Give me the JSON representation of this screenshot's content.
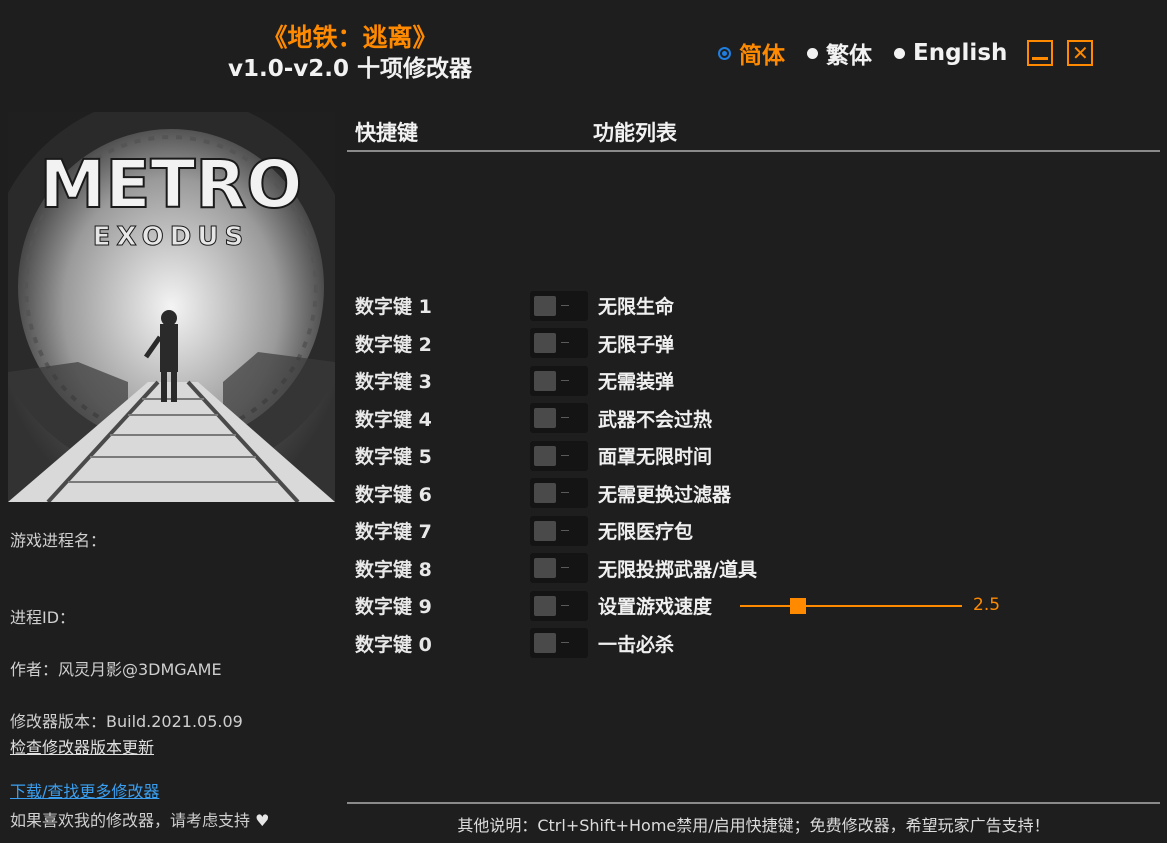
{
  "header": {
    "title": "《地铁：逃离》",
    "subtitle": "v1.0-v2.0 十项修改器"
  },
  "languages": [
    {
      "label": "简体",
      "selected": true
    },
    {
      "label": "繁体",
      "selected": false
    },
    {
      "label": "English",
      "selected": false
    }
  ],
  "cover": {
    "logo": "METRO",
    "sublogo": "EXODUS"
  },
  "info": {
    "process_name_label": "游戏进程名：",
    "process_id_label": "进程ID：",
    "author": "作者：风灵月影@3DMGAME",
    "version": "修改器版本：Build.2021.05.09",
    "check_update": "检查修改器版本更新",
    "download_more": "下载/查找更多修改器",
    "support_text": "如果喜欢我的修改器，请考虑支持",
    "heart_icon": "heart-icon"
  },
  "table": {
    "col_hotkey": "快捷键",
    "col_feature": "功能列表",
    "rows": [
      {
        "hotkey": "数字键 1",
        "feature": "无限生命"
      },
      {
        "hotkey": "数字键 2",
        "feature": "无限子弹"
      },
      {
        "hotkey": "数字键 3",
        "feature": "无需装弹"
      },
      {
        "hotkey": "数字键 4",
        "feature": "武器不会过热"
      },
      {
        "hotkey": "数字键 5",
        "feature": "面罩无限时间"
      },
      {
        "hotkey": "数字键 6",
        "feature": "无需更换过滤器"
      },
      {
        "hotkey": "数字键 7",
        "feature": "无限医疗包"
      },
      {
        "hotkey": "数字键 8",
        "feature": "无限投掷武器/道具"
      },
      {
        "hotkey": "数字键 9",
        "feature": "设置游戏速度"
      },
      {
        "hotkey": "数字键 0",
        "feature": "一击必杀"
      }
    ],
    "speed_value": "2.5"
  },
  "footer": "其他说明：Ctrl+Shift+Home禁用/启用快捷键；免费修改器，希望玩家广告支持！",
  "colors": {
    "accent": "#ff8a00",
    "radio_selected": "#1e7fe0",
    "background": "#1e1e1e"
  }
}
